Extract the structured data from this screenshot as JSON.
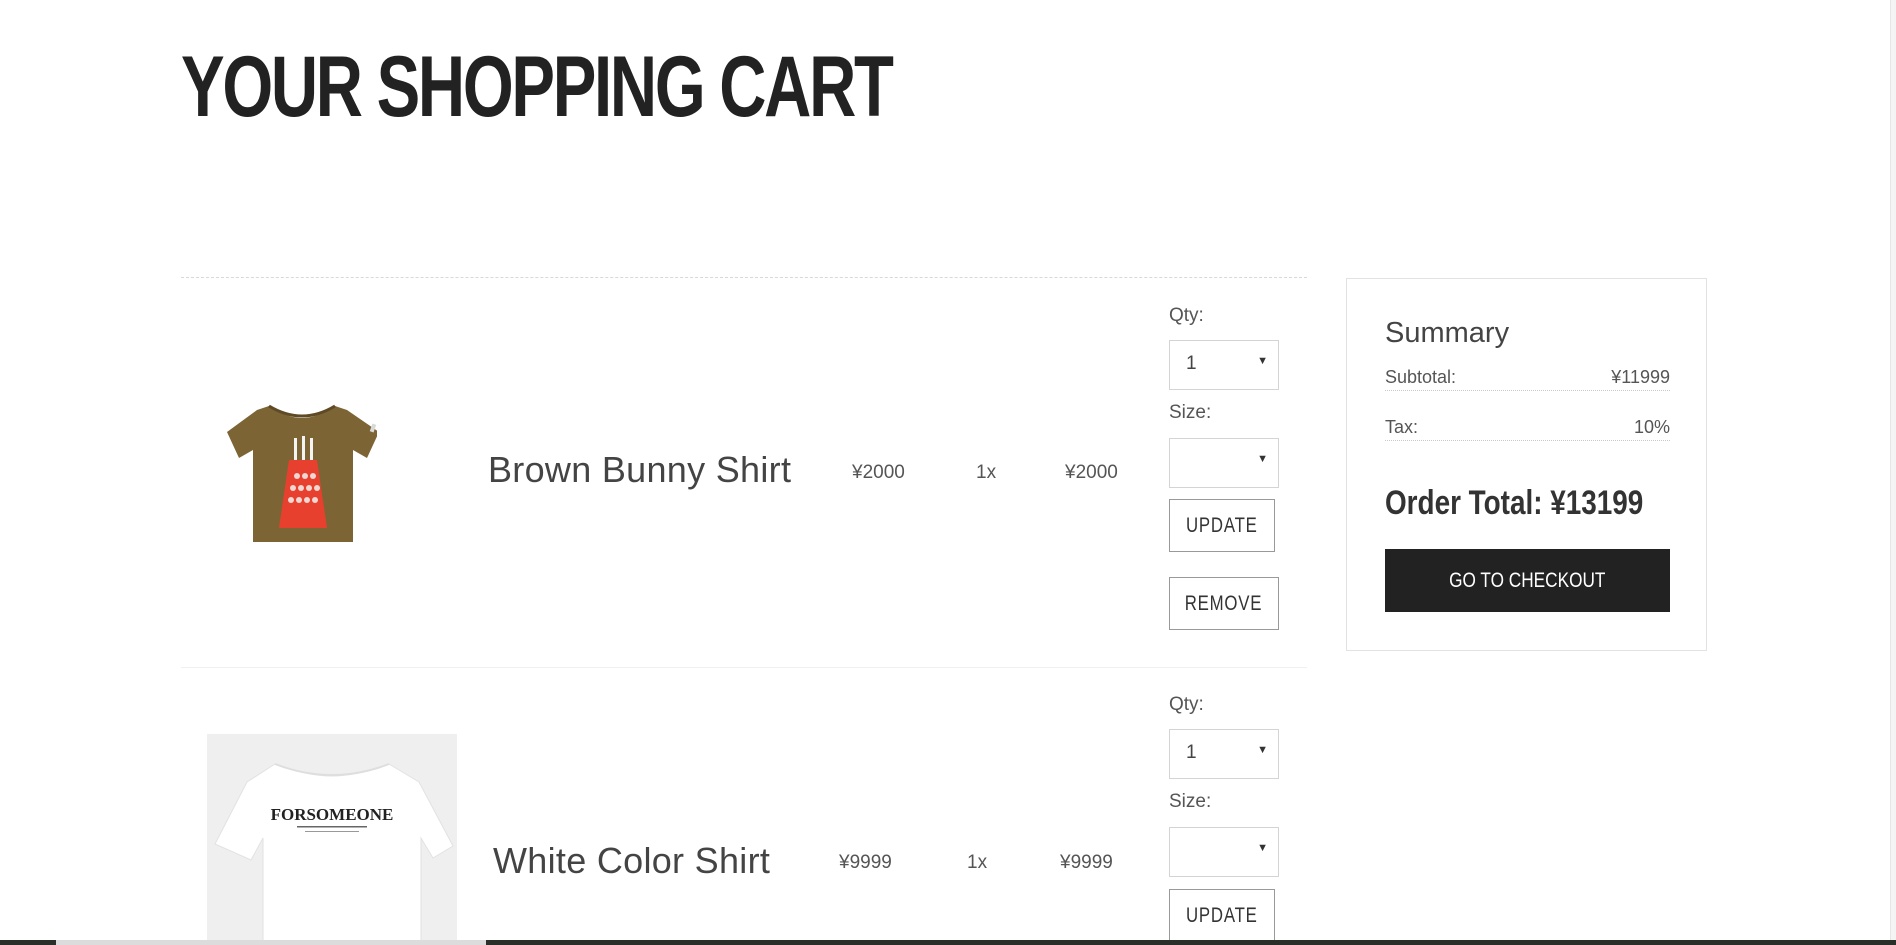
{
  "page": {
    "title": "YOUR SHOPPING CART"
  },
  "cart": {
    "items": [
      {
        "name": "Brown Bunny Shirt",
        "price": "¥2000",
        "quantity_label": "1x",
        "line_total": "¥2000",
        "image": "brown-bunny-shirt-thumbnail",
        "qty_label": "Qty:",
        "qty_value": "1",
        "size_label": "Size:",
        "size_value": "",
        "update_label": "UPDATE",
        "remove_label": "REMOVE"
      },
      {
        "name": "White Color Shirt",
        "price": "¥9999",
        "quantity_label": "1x",
        "line_total": "¥9999",
        "image": "white-color-shirt-thumbnail",
        "image_text": "FORSOMEONE",
        "qty_label": "Qty:",
        "qty_value": "1",
        "size_label": "Size:",
        "size_value": "",
        "update_label": "UPDATE"
      }
    ]
  },
  "summary": {
    "title": "Summary",
    "subtotal_label": "Subtotal:",
    "subtotal_value": "¥11999",
    "tax_label": "Tax:",
    "tax_value": "10%",
    "order_total": "Order Total: ¥13199",
    "checkout_label": "GO TO CHECKOUT"
  },
  "icons": {
    "select_caret": "caret-down-icon"
  },
  "colors": {
    "checkout_bg": "#222222",
    "text": "#444444",
    "shirt_brown": "#7d6435",
    "shirt_print": "#e8402e"
  }
}
